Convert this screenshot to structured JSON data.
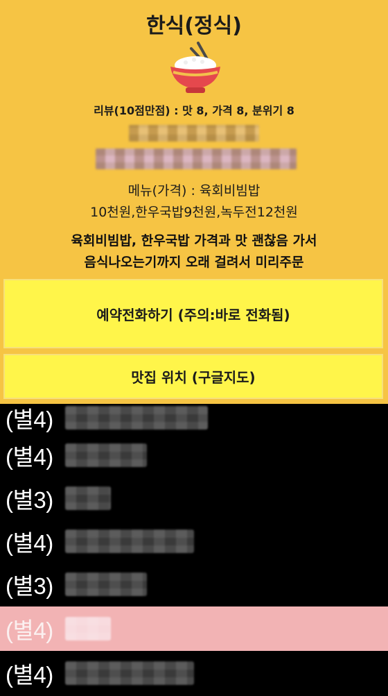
{
  "header": {
    "title": "한식(정식)",
    "review": "리뷰(10점만점) : 맛 8, 가격 8, 분위기 8",
    "menu_line1": "메뉴(가격) : 육회비빔밥",
    "menu_line2": "10천원,한우국밥9천원,녹두전12천원",
    "comment_line1": "육회비빔밥, 한우국밥 가격과 맛 괜찮음 가서",
    "comment_line2": "음식나오는기까지 오래 걸려서 미리주문",
    "food_icon": "rice-bowl-with-chopsticks-icon"
  },
  "buttons": {
    "call": "예약전화하기 (주의:바로 전화됨)",
    "map": "맛집 위치 (구글지도)"
  },
  "list": [
    {
      "stars": "(별4)"
    },
    {
      "stars": "(별4)"
    },
    {
      "stars": "(별3)"
    },
    {
      "stars": "(별4)"
    },
    {
      "stars": "(별3)"
    },
    {
      "stars": "(별4)",
      "highlighted": true
    },
    {
      "stars": "(별4)"
    }
  ],
  "colors": {
    "panel": "#f6c444",
    "button": "#fff54a",
    "list_background": "#000000",
    "highlight_row": "#f2b3b4"
  }
}
